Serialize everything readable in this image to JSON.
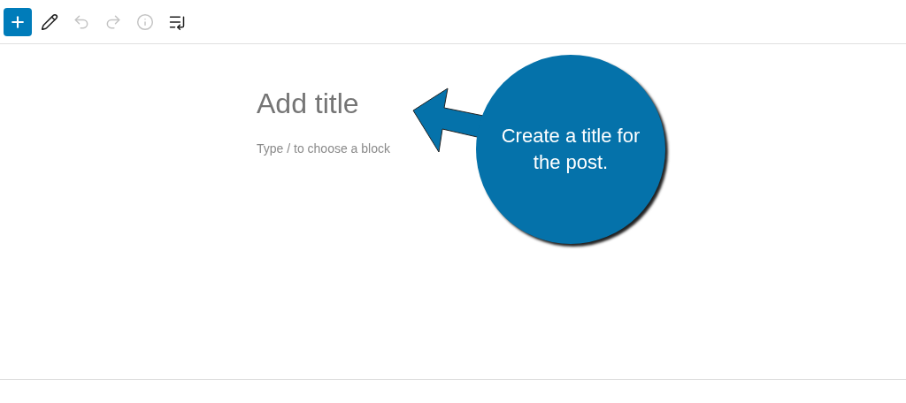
{
  "toolbar": [
    {
      "kind": "add",
      "disabled": false
    },
    {
      "kind": "tools",
      "disabled": false
    },
    {
      "kind": "undo",
      "disabled": true
    },
    {
      "kind": "redo",
      "disabled": true
    },
    {
      "kind": "info",
      "disabled": true
    },
    {
      "kind": "outline",
      "disabled": false
    }
  ],
  "editor": {
    "title": {
      "placeholder": "Add title"
    },
    "block": {
      "placeholder": "Type / to choose a block"
    }
  },
  "callout": {
    "text": "Create a title for the post."
  }
}
